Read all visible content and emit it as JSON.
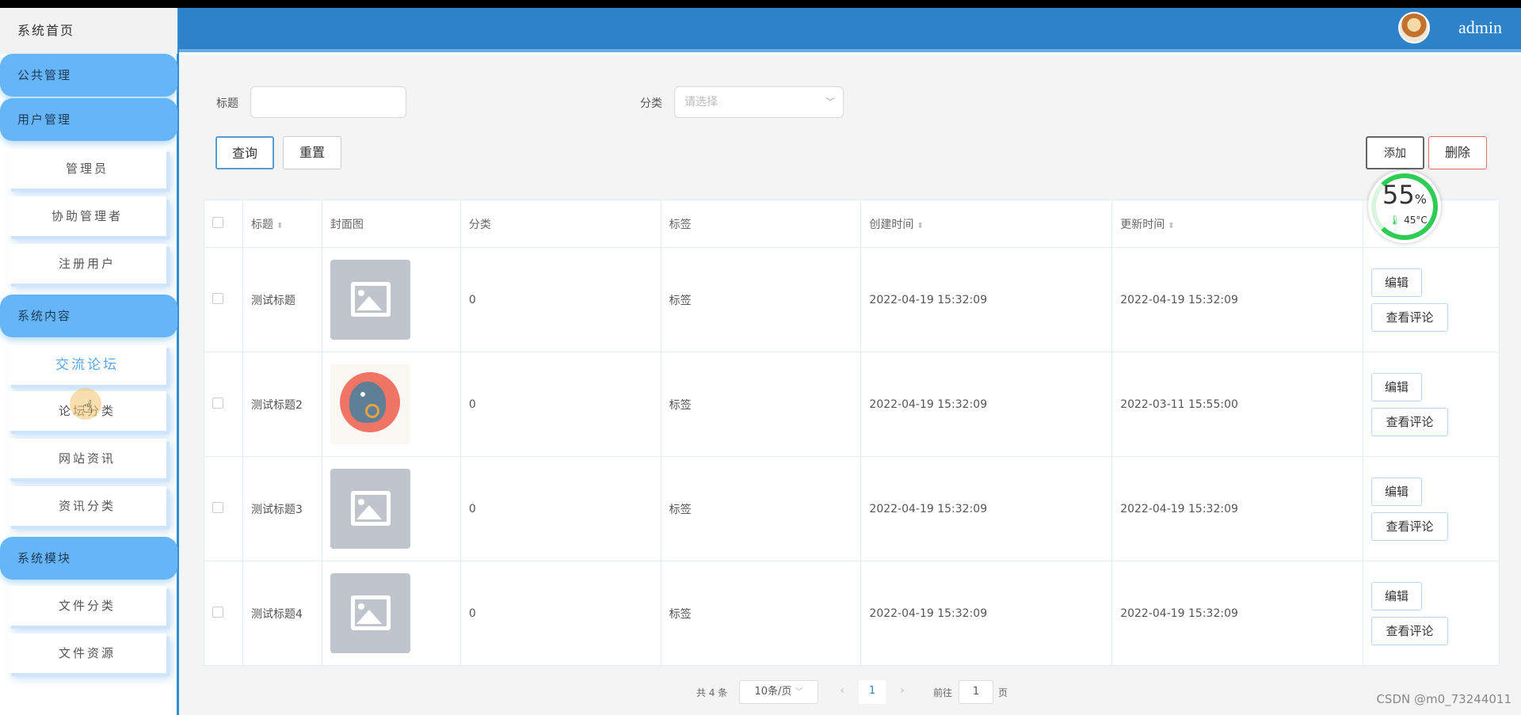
{
  "sidebar": {
    "home": "系统首页",
    "groups": [
      {
        "label": "公共管理"
      },
      {
        "label": "用户管理",
        "items": [
          "管理员",
          "协助管理者",
          "注册用户"
        ]
      },
      {
        "label": "系统内容",
        "items": [
          "交流论坛",
          "论坛分类",
          "网站资讯",
          "资讯分类"
        ]
      },
      {
        "label": "系统模块",
        "items": [
          "文件分类",
          "文件资源"
        ]
      }
    ],
    "active_item": "交流论坛"
  },
  "header": {
    "user": "admin"
  },
  "filters": {
    "title_label": "标题",
    "title_value": "",
    "category_label": "分类",
    "category_placeholder": "请选择"
  },
  "actions": {
    "query": "查询",
    "reset": "重置",
    "add": "添加",
    "delete": "删除"
  },
  "monitor": {
    "percent": "55",
    "percent_sign": "%",
    "temp": "45°C"
  },
  "table": {
    "headers": [
      "标题",
      "封面图",
      "分类",
      "标签",
      "创建时间",
      "更新时间"
    ],
    "rows": [
      {
        "title": "测试标题",
        "cover": "placeholder",
        "category": "0",
        "tag": "标签",
        "created": "2022-04-19 15:32:09",
        "updated": "2022-04-19 15:32:09"
      },
      {
        "title": "测试标题2",
        "cover": "bird",
        "category": "0",
        "tag": "标签",
        "created": "2022-04-19 15:32:09",
        "updated": "2022-03-11 15:55:00"
      },
      {
        "title": "测试标题3",
        "cover": "placeholder",
        "category": "0",
        "tag": "标签",
        "created": "2022-04-19 15:32:09",
        "updated": "2022-04-19 15:32:09"
      },
      {
        "title": "测试标题4",
        "cover": "placeholder",
        "category": "0",
        "tag": "标签",
        "created": "2022-04-19 15:32:09",
        "updated": "2022-04-19 15:32:09"
      }
    ],
    "edit_label": "编辑",
    "view_comments_label": "查看评论"
  },
  "pagination": {
    "total": "共 4 条",
    "page_size": "10条/页",
    "current": "1",
    "goto_label": "前往",
    "goto_value": "1",
    "page_suffix": "页"
  },
  "watermark": "CSDN @m0_73244011"
}
